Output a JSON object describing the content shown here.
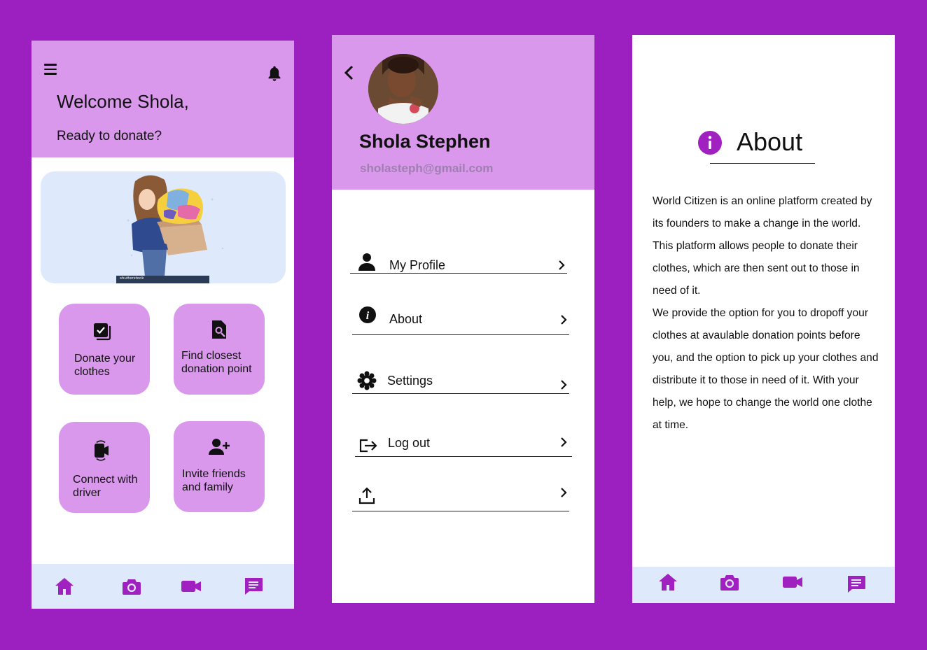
{
  "colors": {
    "background": "#9c1fbf",
    "header": "#d998ec",
    "nav": "#deeafb",
    "icon_accent": "#a020c0"
  },
  "home": {
    "greeting": "Welcome Shola,",
    "subtitle": "Ready to donate?",
    "banner_watermark": "shutterstock",
    "actions": [
      {
        "label": "Donate your\nclothes",
        "icon": "donate-checkbox-icon"
      },
      {
        "label": "Find closest\ndonation point",
        "icon": "search-document-icon"
      },
      {
        "label": "Connect with\ndriver",
        "icon": "video-call-icon"
      },
      {
        "label": "Invite friends\nand family",
        "icon": "add-person-icon"
      }
    ]
  },
  "profile": {
    "name": "Shola Stephen",
    "email": "sholasteph@gmail.com",
    "menu": [
      {
        "label": "My Profile",
        "icon": "person-icon"
      },
      {
        "label": "About",
        "icon": "info-icon"
      },
      {
        "label": "Settings",
        "icon": "settings-gear-icon"
      },
      {
        "label": "Log out",
        "icon": "logout-icon"
      },
      {
        "label": "",
        "icon": "share-upload-icon"
      }
    ]
  },
  "about": {
    "title": "About",
    "paragraphs": [
      "World Citizen is an online platform created by its founders to make a change in the world. This platform allows people to donate their clothes, which are then sent out to those in need of it.",
      "We provide the option for you to dropoff your clothes at avaulable donation points before you, and the option to pick up your clothes and distribute it to those in need of it. With your help, we hope to change the world one clothe at time."
    ]
  },
  "nav": {
    "items": [
      "home-icon",
      "camera-icon",
      "video-icon",
      "chat-icon"
    ]
  }
}
